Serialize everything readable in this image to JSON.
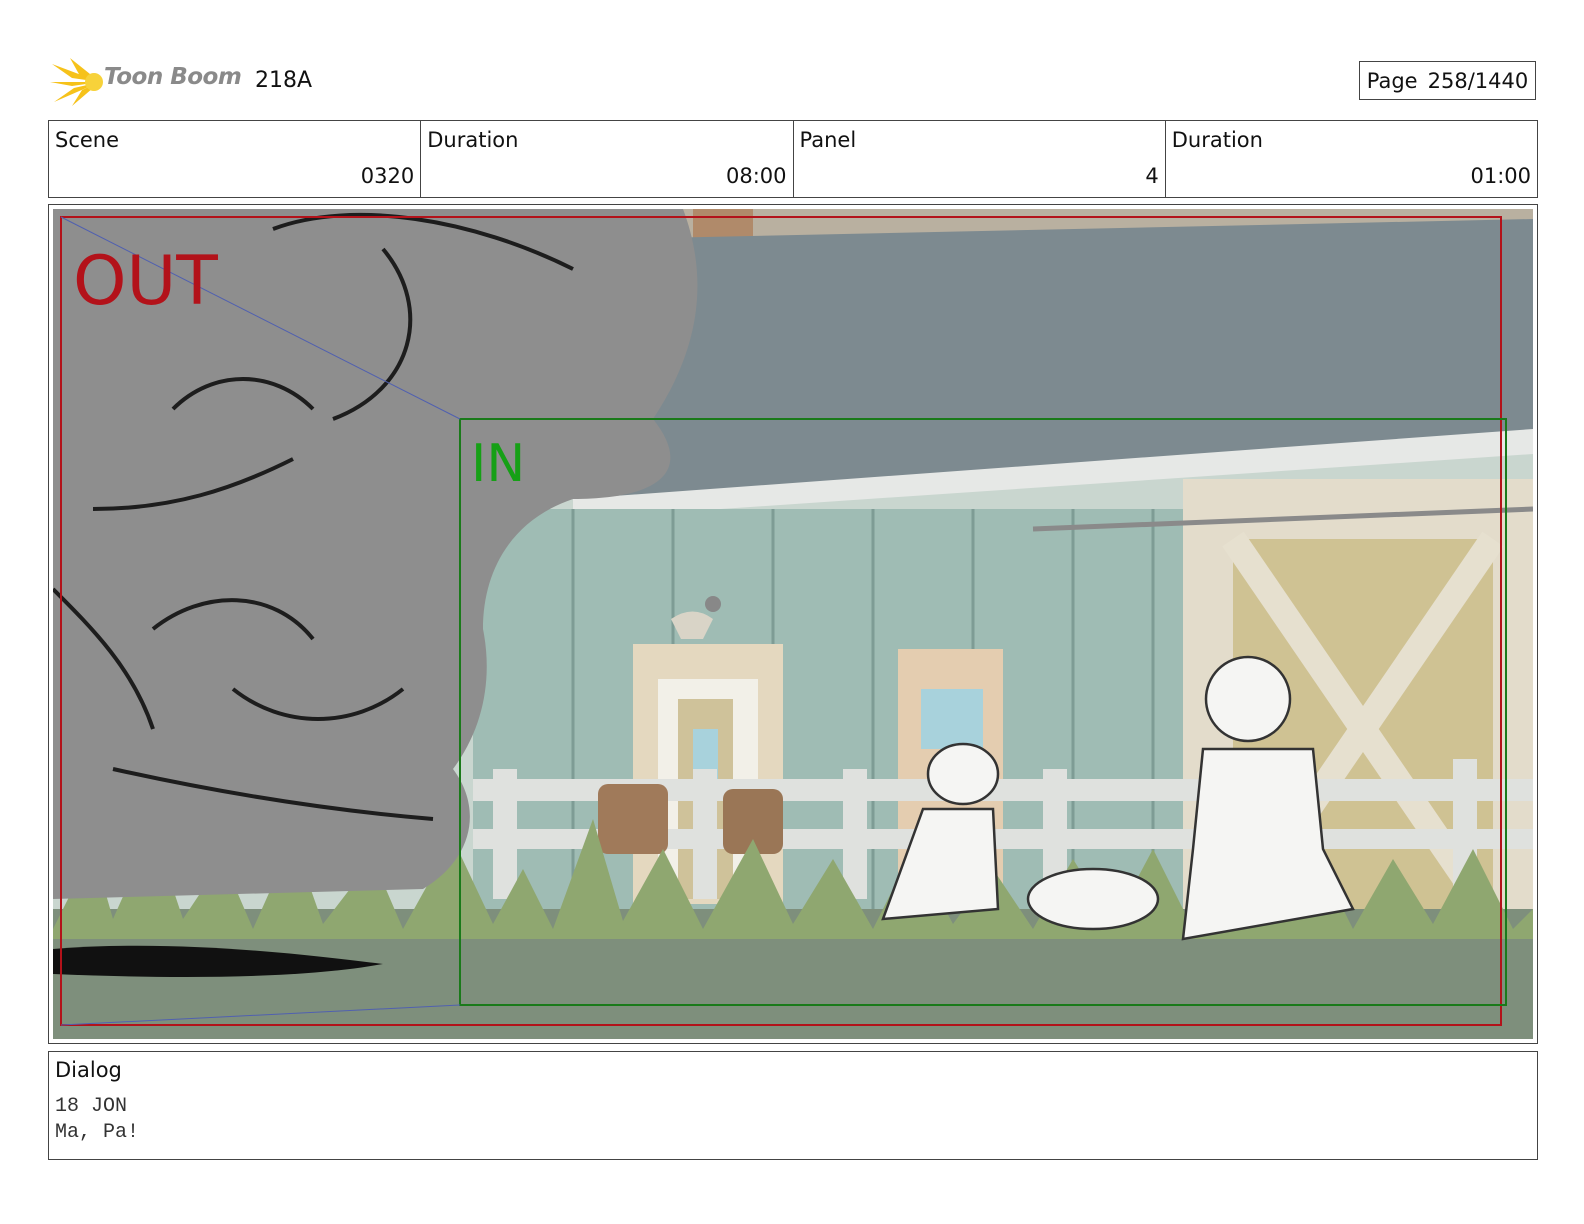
{
  "header": {
    "logo_text": "Toon Boom",
    "project_id": "218A",
    "page_label": "Page",
    "page_value": "258/1440"
  },
  "info": {
    "scene_label": "Scene",
    "scene_value": "0320",
    "scene_duration_label": "Duration",
    "scene_duration_value": "08:00",
    "panel_label": "Panel",
    "panel_value": "4",
    "panel_duration_label": "Duration",
    "panel_duration_value": "01:00"
  },
  "panel": {
    "out_label": "OUT",
    "in_label": "IN",
    "colors": {
      "out_frame": "#b3121a",
      "in_frame": "#1a7a1a",
      "in_text": "#16a016"
    }
  },
  "dialog": {
    "label": "Dialog",
    "lines": [
      "18 JON",
      "Ma, Pa!"
    ]
  }
}
